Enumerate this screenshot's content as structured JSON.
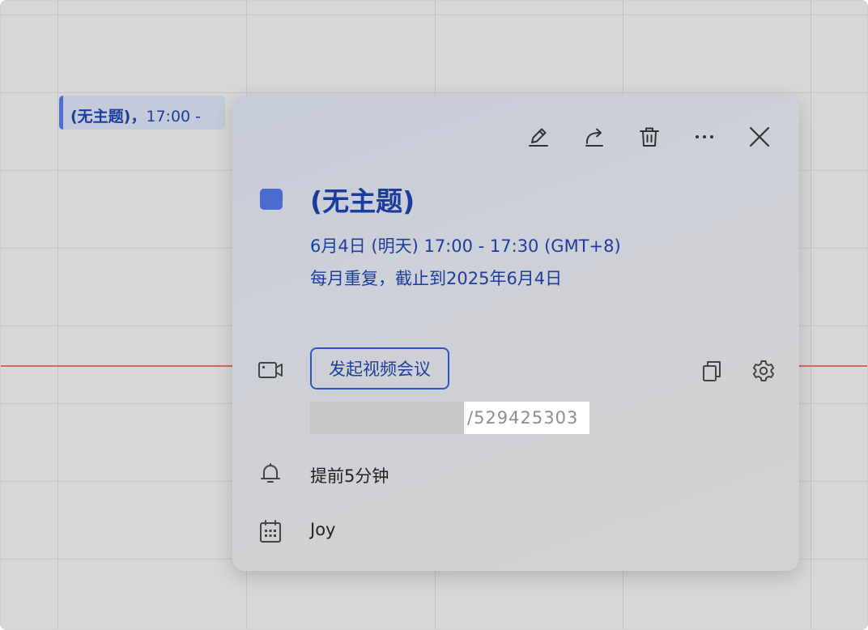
{
  "calendar_grid": {
    "event_chip": {
      "title": "(无主题)，",
      "time": "17:00 -"
    }
  },
  "popover": {
    "toolbar": {
      "edit_icon": "pencil-icon",
      "share_icon": "share-icon",
      "delete_icon": "trash-icon",
      "more_icon": "ellipsis-icon",
      "close_icon": "close-icon"
    },
    "event": {
      "color": "#4b6ccf",
      "title": "(无主题)",
      "datetime": "6月4日 (明天) 17:00 - 17:30 (GMT+8)",
      "recurrence": "每月重复，截止到2025年6月4日"
    },
    "meeting": {
      "start_video_label": "发起视频会议",
      "link_suffix": "/529425303",
      "copy_icon": "copy-icon",
      "settings_icon": "gear-icon"
    },
    "reminder": {
      "label": "提前5分钟"
    },
    "calendar": {
      "owner": "Joy"
    }
  },
  "colors": {
    "accent": "#1d3e9e",
    "button_border": "#2f55c8",
    "now_line": "#d06a5e"
  }
}
